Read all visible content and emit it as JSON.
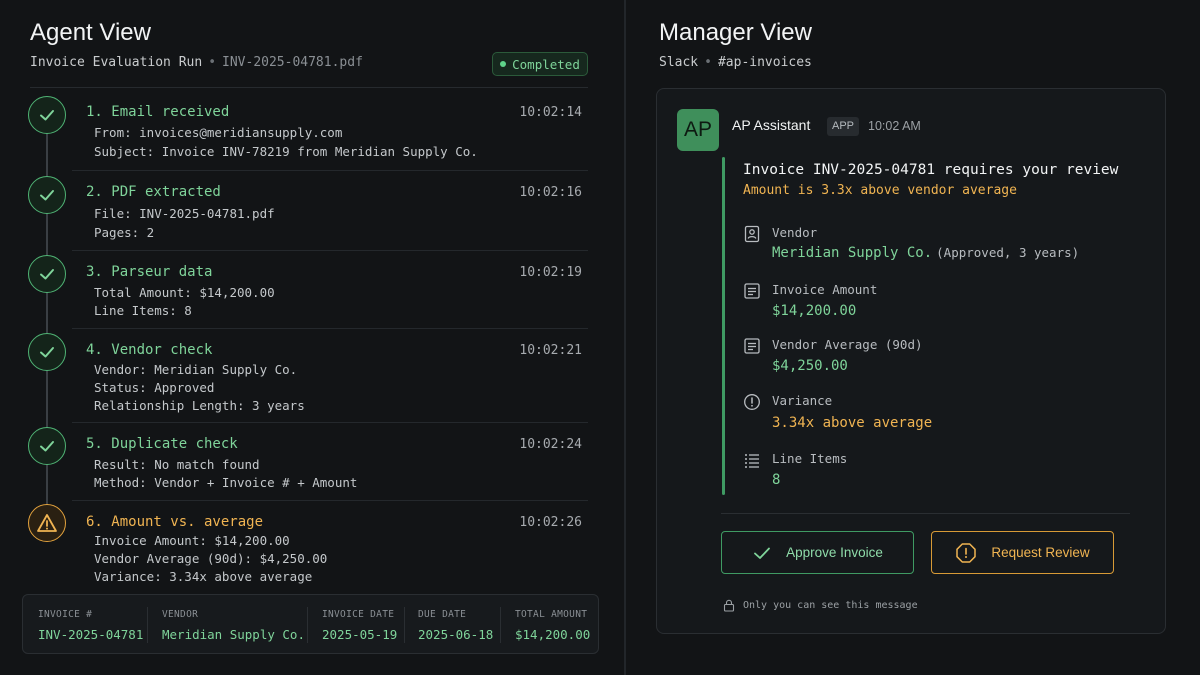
{
  "agent_view": {
    "title": "Agent View",
    "subtitle": "Invoice Evaluation Run",
    "file": "INV-2025-04781.pdf",
    "status": "Completed",
    "steps": [
      {
        "title": "1. Email received",
        "time": "10:02:14",
        "lines": [
          "From: invoices@meridiansupply.com",
          "Subject: Invoice INV-78219 from Meridian Supply Co."
        ],
        "state": "done"
      },
      {
        "title": "2. PDF extracted",
        "time": "10:02:16",
        "lines": [
          "File: INV-2025-04781.pdf",
          "Pages: 2"
        ],
        "state": "done"
      },
      {
        "title": "3. Parseur data",
        "time": "10:02:19",
        "lines": [
          "Total Amount: $14,200.00",
          "Line Items: 8"
        ],
        "state": "done"
      },
      {
        "title": "4. Vendor check",
        "time": "10:02:21",
        "lines": [
          "Vendor: Meridian Supply Co.",
          "Status: Approved",
          "Relationship Length: 3 years"
        ],
        "state": "done"
      },
      {
        "title": "5. Duplicate check",
        "time": "10:02:24",
        "lines": [
          "Result: No match found",
          "Method: Vendor + Invoice # + Amount"
        ],
        "state": "done"
      },
      {
        "title": "6. Amount vs. average",
        "time": "10:02:26",
        "lines": [
          "Invoice Amount: $14,200.00",
          "Vendor Average (90d): $4,250.00",
          "Variance: 3.34x above average"
        ],
        "state": "warning"
      }
    ],
    "summary": [
      {
        "label": "INVOICE #",
        "value": "INV-2025-04781"
      },
      {
        "label": "VENDOR",
        "value": "Meridian Supply Co."
      },
      {
        "label": "INVOICE DATE",
        "value": "2025-05-19"
      },
      {
        "label": "DUE DATE",
        "value": "2025-06-18"
      },
      {
        "label": "TOTAL AMOUNT",
        "value": "$14,200.00"
      }
    ]
  },
  "manager_view": {
    "title": "Manager View",
    "channel_app": "Slack",
    "channel": "#ap-invoices",
    "message": {
      "avatar": "AP",
      "sender": "AP Assistant",
      "tag": "APP",
      "time": "10:02 AM",
      "title": "Invoice INV-2025-04781 requires your review",
      "subtitle": "Amount is 3.3x above vendor average",
      "fields": {
        "vendor_label": "Vendor",
        "vendor_value": "Meridian Supply Co.",
        "vendor_note": "(Approved, 3 years)",
        "amount_label": "Invoice Amount",
        "amount_value": "$14,200.00",
        "avg_label": "Vendor Average (90d)",
        "avg_value": "$4,250.00",
        "variance_label": "Variance",
        "variance_value": "3.34x above average",
        "items_label": "Line Items",
        "items_value": "8"
      },
      "approve_label": "Approve Invoice",
      "review_label": "Request Review",
      "privacy": "Only you can see this message"
    }
  },
  "colors": {
    "background": "#121416",
    "success": "#7fd49a",
    "warning": "#f0b452",
    "accent_green": "#3f9a63"
  }
}
